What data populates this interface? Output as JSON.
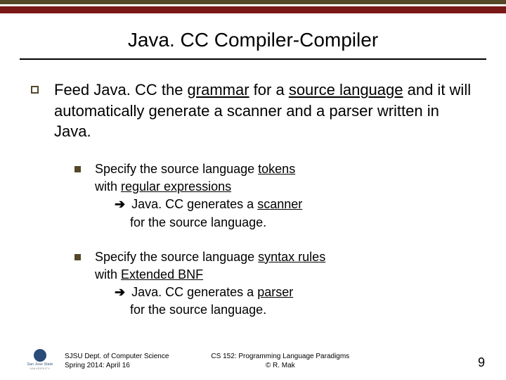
{
  "title": "Java. CC Compiler-Compiler",
  "main": {
    "intro_pre": "Feed Java. CC the ",
    "intro_u1": "grammar",
    "intro_mid1": " for a ",
    "intro_u2": "source language",
    "intro_post": " and it will automatically generate a scanner and a parser written in Java."
  },
  "sub1": {
    "line1_pre": "Specify the source language ",
    "line1_u": "tokens",
    "line2_pre": "with ",
    "line2_u": "regular expressions",
    "line3_arrow": "➔",
    "line3_pre": " Java. CC generates a ",
    "line3_u": "scanner",
    "line4": "for the source language."
  },
  "sub2": {
    "line1_pre": "Specify the source language ",
    "line1_u": "syntax rules",
    "line2_pre": "with ",
    "line2_u": "Extended BNF",
    "line3_arrow": "➔",
    "line3_pre": " Java. CC generates a ",
    "line3_u": "parser",
    "line4": "for the source language."
  },
  "footer": {
    "logo_name": "San Jose State",
    "logo_uni": "UNIVERSITY",
    "left1": "SJSU Dept. of Computer Science",
    "left2": "Spring 2014: April 16",
    "center1": "CS 152: Programming Language Paradigms",
    "center2": "© R. Mak",
    "page": "9"
  }
}
